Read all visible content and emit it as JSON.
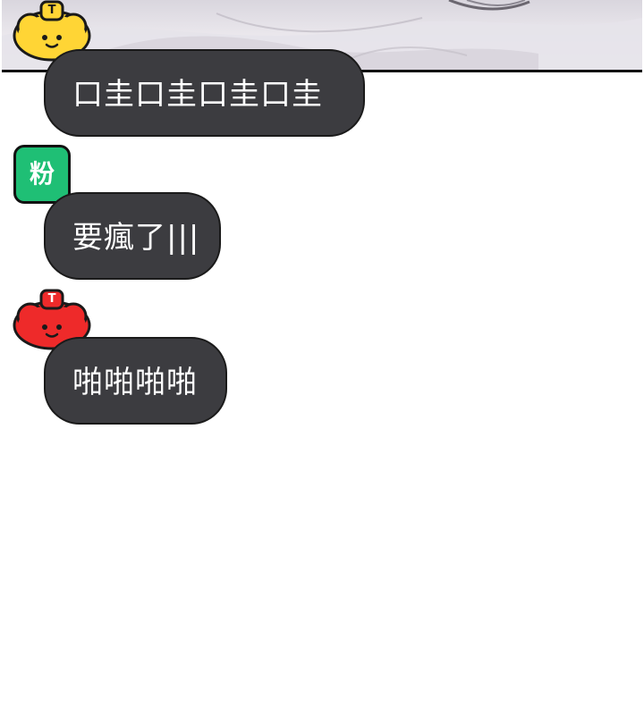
{
  "messages": [
    {
      "text": "口圭口圭口圭口圭"
    },
    {
      "text": "要瘋了|||"
    },
    {
      "text": "啪啪啪啪"
    }
  ],
  "avatars": {
    "yellow": {
      "badge": "T",
      "color": "#ffd535",
      "icon": "yellow-bun-avatar-icon"
    },
    "green": {
      "label": "粉",
      "color": "#1fbf75"
    },
    "red": {
      "badge": "T",
      "color": "#ee2a2a",
      "icon": "red-bun-avatar-icon"
    }
  },
  "colors": {
    "bubble": "#3c3c40",
    "bubble_text": "#ffffff",
    "background": "#ffffff"
  }
}
